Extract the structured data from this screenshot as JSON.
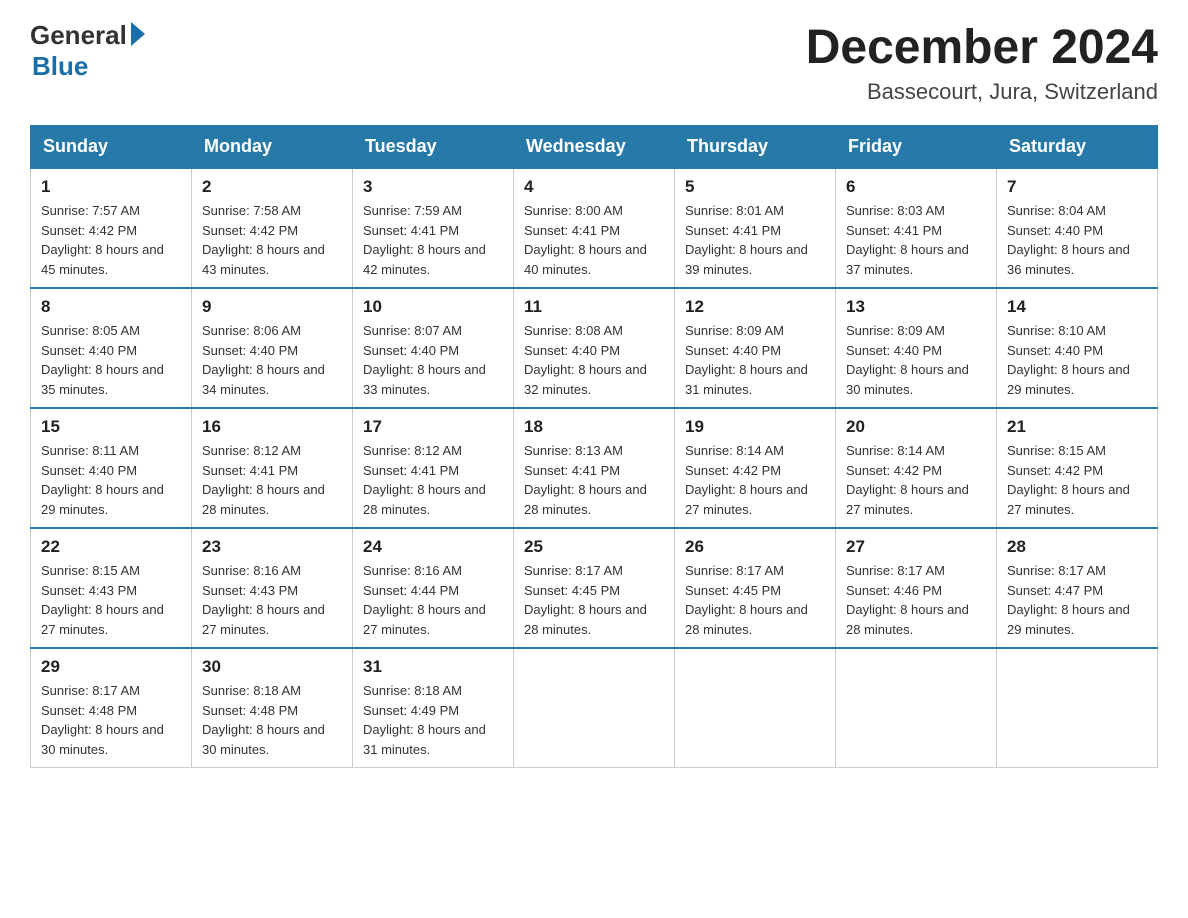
{
  "logo": {
    "general": "General",
    "blue": "Blue"
  },
  "title": {
    "month": "December 2024",
    "location": "Bassecourt, Jura, Switzerland"
  },
  "headers": [
    "Sunday",
    "Monday",
    "Tuesday",
    "Wednesday",
    "Thursday",
    "Friday",
    "Saturday"
  ],
  "weeks": [
    [
      {
        "day": "1",
        "sunrise": "7:57 AM",
        "sunset": "4:42 PM",
        "daylight": "8 hours and 45 minutes."
      },
      {
        "day": "2",
        "sunrise": "7:58 AM",
        "sunset": "4:42 PM",
        "daylight": "8 hours and 43 minutes."
      },
      {
        "day": "3",
        "sunrise": "7:59 AM",
        "sunset": "4:41 PM",
        "daylight": "8 hours and 42 minutes."
      },
      {
        "day": "4",
        "sunrise": "8:00 AM",
        "sunset": "4:41 PM",
        "daylight": "8 hours and 40 minutes."
      },
      {
        "day": "5",
        "sunrise": "8:01 AM",
        "sunset": "4:41 PM",
        "daylight": "8 hours and 39 minutes."
      },
      {
        "day": "6",
        "sunrise": "8:03 AM",
        "sunset": "4:41 PM",
        "daylight": "8 hours and 37 minutes."
      },
      {
        "day": "7",
        "sunrise": "8:04 AM",
        "sunset": "4:40 PM",
        "daylight": "8 hours and 36 minutes."
      }
    ],
    [
      {
        "day": "8",
        "sunrise": "8:05 AM",
        "sunset": "4:40 PM",
        "daylight": "8 hours and 35 minutes."
      },
      {
        "day": "9",
        "sunrise": "8:06 AM",
        "sunset": "4:40 PM",
        "daylight": "8 hours and 34 minutes."
      },
      {
        "day": "10",
        "sunrise": "8:07 AM",
        "sunset": "4:40 PM",
        "daylight": "8 hours and 33 minutes."
      },
      {
        "day": "11",
        "sunrise": "8:08 AM",
        "sunset": "4:40 PM",
        "daylight": "8 hours and 32 minutes."
      },
      {
        "day": "12",
        "sunrise": "8:09 AM",
        "sunset": "4:40 PM",
        "daylight": "8 hours and 31 minutes."
      },
      {
        "day": "13",
        "sunrise": "8:09 AM",
        "sunset": "4:40 PM",
        "daylight": "8 hours and 30 minutes."
      },
      {
        "day": "14",
        "sunrise": "8:10 AM",
        "sunset": "4:40 PM",
        "daylight": "8 hours and 29 minutes."
      }
    ],
    [
      {
        "day": "15",
        "sunrise": "8:11 AM",
        "sunset": "4:40 PM",
        "daylight": "8 hours and 29 minutes."
      },
      {
        "day": "16",
        "sunrise": "8:12 AM",
        "sunset": "4:41 PM",
        "daylight": "8 hours and 28 minutes."
      },
      {
        "day": "17",
        "sunrise": "8:12 AM",
        "sunset": "4:41 PM",
        "daylight": "8 hours and 28 minutes."
      },
      {
        "day": "18",
        "sunrise": "8:13 AM",
        "sunset": "4:41 PM",
        "daylight": "8 hours and 28 minutes."
      },
      {
        "day": "19",
        "sunrise": "8:14 AM",
        "sunset": "4:42 PM",
        "daylight": "8 hours and 27 minutes."
      },
      {
        "day": "20",
        "sunrise": "8:14 AM",
        "sunset": "4:42 PM",
        "daylight": "8 hours and 27 minutes."
      },
      {
        "day": "21",
        "sunrise": "8:15 AM",
        "sunset": "4:42 PM",
        "daylight": "8 hours and 27 minutes."
      }
    ],
    [
      {
        "day": "22",
        "sunrise": "8:15 AM",
        "sunset": "4:43 PM",
        "daylight": "8 hours and 27 minutes."
      },
      {
        "day": "23",
        "sunrise": "8:16 AM",
        "sunset": "4:43 PM",
        "daylight": "8 hours and 27 minutes."
      },
      {
        "day": "24",
        "sunrise": "8:16 AM",
        "sunset": "4:44 PM",
        "daylight": "8 hours and 27 minutes."
      },
      {
        "day": "25",
        "sunrise": "8:17 AM",
        "sunset": "4:45 PM",
        "daylight": "8 hours and 28 minutes."
      },
      {
        "day": "26",
        "sunrise": "8:17 AM",
        "sunset": "4:45 PM",
        "daylight": "8 hours and 28 minutes."
      },
      {
        "day": "27",
        "sunrise": "8:17 AM",
        "sunset": "4:46 PM",
        "daylight": "8 hours and 28 minutes."
      },
      {
        "day": "28",
        "sunrise": "8:17 AM",
        "sunset": "4:47 PM",
        "daylight": "8 hours and 29 minutes."
      }
    ],
    [
      {
        "day": "29",
        "sunrise": "8:17 AM",
        "sunset": "4:48 PM",
        "daylight": "8 hours and 30 minutes."
      },
      {
        "day": "30",
        "sunrise": "8:18 AM",
        "sunset": "4:48 PM",
        "daylight": "8 hours and 30 minutes."
      },
      {
        "day": "31",
        "sunrise": "8:18 AM",
        "sunset": "4:49 PM",
        "daylight": "8 hours and 31 minutes."
      },
      null,
      null,
      null,
      null
    ]
  ]
}
